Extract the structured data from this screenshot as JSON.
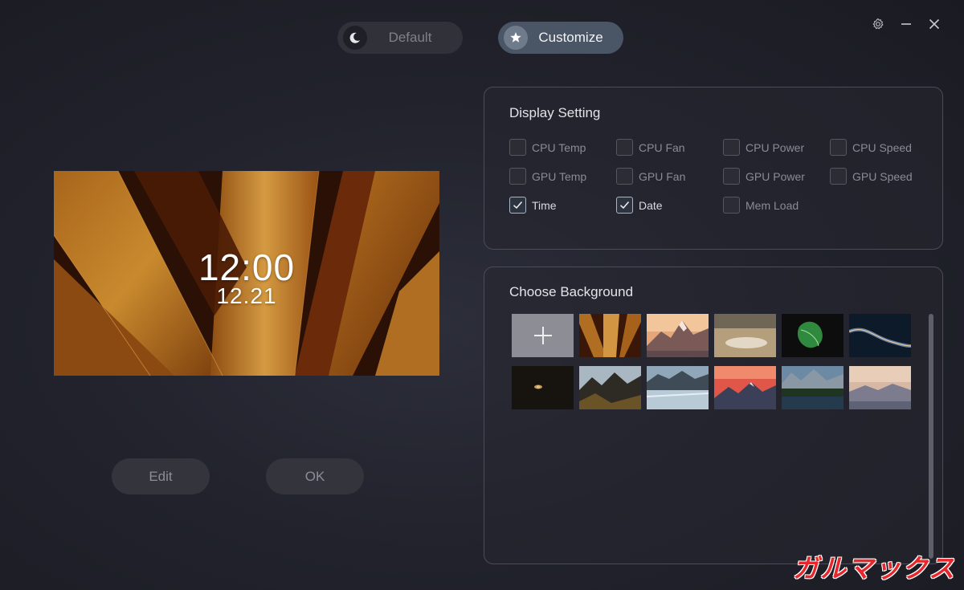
{
  "modes": {
    "default_label": "Default",
    "customize_label": "Customize",
    "default_icon": "moon-icon",
    "customize_icon": "star-icon",
    "active": "Customize"
  },
  "window_controls": [
    "settings-icon",
    "minimize-icon",
    "close-icon"
  ],
  "preview": {
    "time": "12:00",
    "date": "12.21",
    "background": "agave-leaves"
  },
  "buttons": {
    "edit": "Edit",
    "ok": "OK"
  },
  "display_setting": {
    "title": "Display Setting",
    "options": [
      {
        "label": "CPU Temp",
        "checked": false
      },
      {
        "label": "CPU Fan",
        "checked": false
      },
      {
        "label": "CPU Power",
        "checked": false
      },
      {
        "label": "CPU Speed",
        "checked": false
      },
      {
        "label": "GPU Temp",
        "checked": false
      },
      {
        "label": "GPU Fan",
        "checked": false
      },
      {
        "label": "GPU Power",
        "checked": false
      },
      {
        "label": "GPU Speed",
        "checked": false
      },
      {
        "label": "Time",
        "checked": true
      },
      {
        "label": "Date",
        "checked": true
      },
      {
        "label": "Mem Load",
        "checked": false
      }
    ]
  },
  "choose_background": {
    "title": "Choose Background",
    "thumbnails": [
      "add-icon",
      "agave-leaves",
      "snowy-peak-sunset",
      "desert-plain",
      "green-leaf",
      "coastal-road-night",
      "night-sky-planet",
      "mountain-range",
      "glacier-lake",
      "red-sky-mountains",
      "lake-forest",
      "misty-mountains"
    ]
  },
  "watermark": "ガルマックス",
  "colors": {
    "accent": "#4a5665",
    "panel_border": "#4a4c57",
    "background": "#22232d"
  }
}
